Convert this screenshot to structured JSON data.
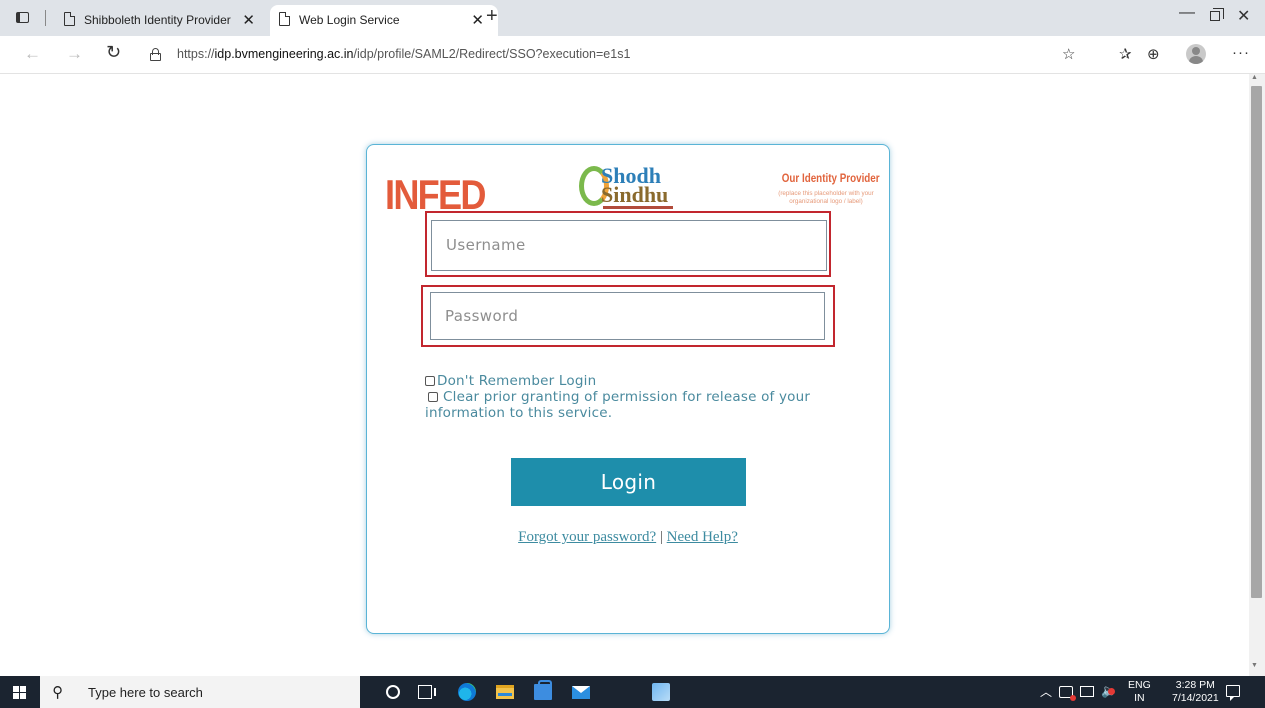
{
  "browser": {
    "tabs": [
      {
        "label": "Shibboleth Identity Provider",
        "active": false
      },
      {
        "label": "Web Login Service",
        "active": true
      }
    ],
    "address": {
      "prefix": "https://",
      "host": "idp.bvmengineering.ac.in",
      "path": "/idp/profile/SAML2/Redirect/SSO?execution=e1s1"
    }
  },
  "card": {
    "logos": {
      "infed": "INFED",
      "shodh_top": "Shodh",
      "shodh_bottom": "Sindhu",
      "idp_title": "Our Identity Provider",
      "idp_subtitle": "(replace this placeholder with your organizational logo / label)"
    },
    "username_placeholder": "Username",
    "password_placeholder": "Password",
    "option_dont_remember": "Don't Remember Login",
    "option_clear_consent": "Clear prior granting of permission for release of your information to this service.",
    "login_label": "Login",
    "forgot_label": "Forgot your password?",
    "separator": "|",
    "help_label": "Need Help?"
  },
  "taskbar": {
    "search_placeholder": "Type here to search",
    "lang_top": "ENG",
    "lang_bottom": "IN",
    "time": "3:28 PM",
    "date": "7/14/2021"
  },
  "colors": {
    "accent": "#1e8eab",
    "highlight": "#c2262e",
    "link": "#3d8ba0"
  }
}
